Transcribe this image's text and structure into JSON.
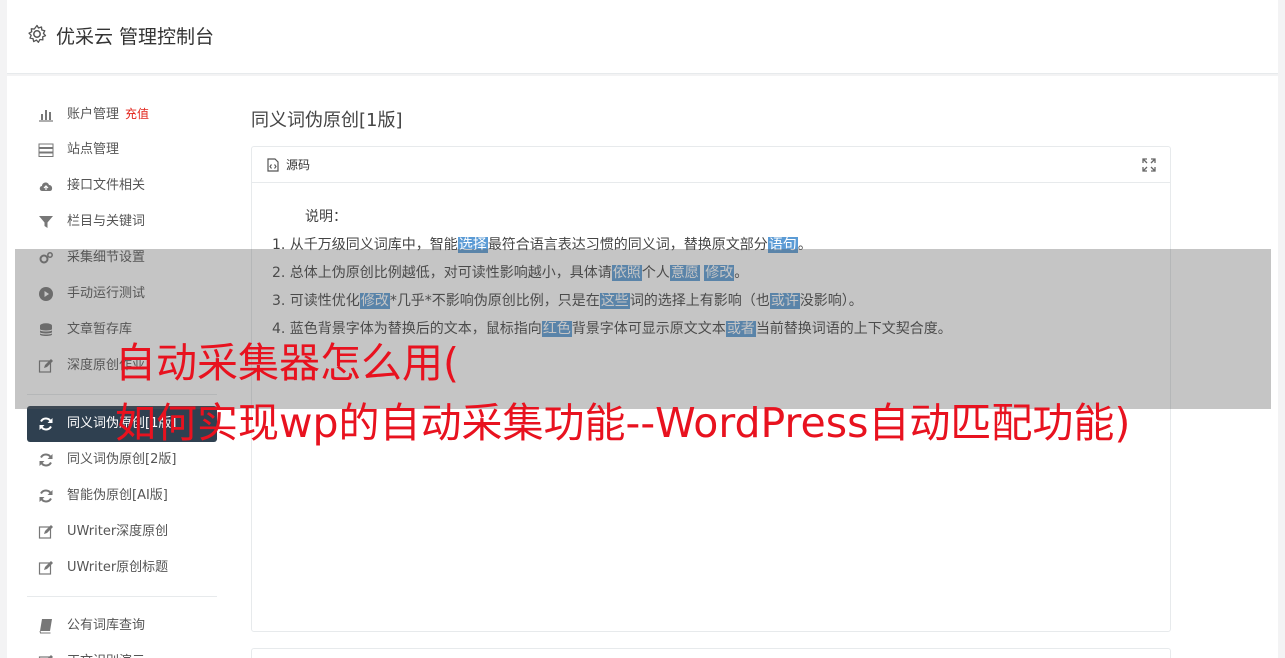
{
  "header": {
    "title": "优采云 管理控制台",
    "icon": "gear-icon"
  },
  "sidebar": {
    "recharge_label": "充值",
    "group1": [
      {
        "label": "账户管理",
        "icon": "bar-chart-icon"
      },
      {
        "label": "站点管理",
        "icon": "server-icon"
      },
      {
        "label": "接口文件相关",
        "icon": "cloud-upload-icon"
      },
      {
        "label": "栏目与关键词",
        "icon": "filter-icon"
      },
      {
        "label": "采集细节设置",
        "icon": "cogs-icon"
      },
      {
        "label": "手动运行测试",
        "icon": "play-circle-icon"
      },
      {
        "label": "文章暂存库",
        "icon": "database-icon"
      },
      {
        "label": "深度原创作业",
        "icon": "edit-icon"
      }
    ],
    "group2": [
      {
        "label": "同义词伪原创[1版]",
        "icon": "refresh-icon",
        "active": true
      },
      {
        "label": "同义词伪原创[2版]",
        "icon": "refresh-icon"
      },
      {
        "label": "智能伪原创[AI版]",
        "icon": "refresh-icon"
      },
      {
        "label": "UWriter深度原创",
        "icon": "edit-icon"
      },
      {
        "label": "UWriter原创标题",
        "icon": "edit-icon"
      }
    ],
    "group3": [
      {
        "label": "公有词库查询",
        "icon": "book-icon"
      },
      {
        "label": "正文识别演示",
        "icon": "edit-icon"
      }
    ]
  },
  "content": {
    "page_title": "同义词伪原创[1版]",
    "panel_title": "源码",
    "intro": "说明：",
    "lines": [
      [
        {
          "t": "1. 从千万级同义词库中，智能"
        },
        {
          "t": "选择",
          "h": true
        },
        {
          "t": "最符合语言表达习惯的同义词，替换原文部分"
        },
        {
          "t": "语句",
          "h": true
        },
        {
          "t": "。"
        }
      ],
      [
        {
          "t": "2. 总体上伪原创比例越低，对可读性影响越小，具体请"
        },
        {
          "t": "依照",
          "h": true
        },
        {
          "t": "个人"
        },
        {
          "t": "意愿",
          "h": true
        },
        {
          "t": " "
        },
        {
          "t": "修改",
          "h": true
        },
        {
          "t": "。"
        }
      ],
      [
        {
          "t": "3. 可读性优化"
        },
        {
          "t": "修改",
          "h": true
        },
        {
          "t": "*几乎*不影响伪原创比例，只是在"
        },
        {
          "t": "这些",
          "h": true
        },
        {
          "t": "词的选择上有影响（也"
        },
        {
          "t": "或许",
          "h": true
        },
        {
          "t": "没影响）。"
        }
      ],
      [
        {
          "t": "4. 蓝色背景字体为替换后的文本，鼠标指向"
        },
        {
          "t": "红色",
          "h": true
        },
        {
          "t": "背景字体可显示原文文本"
        },
        {
          "t": "或者",
          "h": true
        },
        {
          "t": "当前替换词语的上下文契合度。"
        }
      ]
    ]
  },
  "overlay": {
    "line1": "自动采集器怎么用(",
    "line2": "如何实现wp的自动采集功能--WordPress自动匹配功能)"
  },
  "colors": {
    "active_bg": "#2f4050",
    "highlight": "#5b9bd5",
    "recharge": "#e2231a",
    "overlay_text": "#e8121f"
  }
}
